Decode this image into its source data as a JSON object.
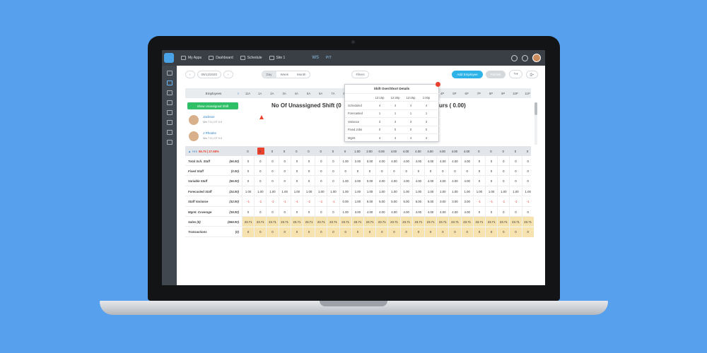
{
  "topbar": {
    "nav": [
      {
        "label": "My Apps"
      },
      {
        "label": "Dashboard"
      },
      {
        "label": "Schedule"
      },
      {
        "label": "Site 1"
      }
    ],
    "brand": "WS",
    "brand2": "PIT"
  },
  "toolbar": {
    "date": "09/13/2020",
    "views": [
      "Day",
      "Week",
      "Month"
    ],
    "active_view": "Day",
    "filters": "Filters",
    "add_employee": "Add Employee",
    "publish": "Publish"
  },
  "grid": {
    "employees_header": "Employees",
    "hours": [
      "11A",
      "1A",
      "2A",
      "3A",
      "4A",
      "5A",
      "6A",
      "7A",
      "8A",
      "9A",
      "10A",
      "11A",
      "12P",
      "1P",
      "2P",
      "3P",
      "4P",
      "5P",
      "6P",
      "7P",
      "8P",
      "9P",
      "10P",
      "11P"
    ],
    "show_unassigned": "Show Unassigned Shift",
    "title_left": "No Of Unassigned Shift (0",
    "title_right": "urs ( 0.00)",
    "employees": [
      {
        "name": "Jackson",
        "hours": "Min 7.5 | OT 0.0"
      },
      {
        "name": "J Rhodes",
        "hours": "Min 7.5 | OT 0.0"
      }
    ],
    "hrs_summary": {
      "label": "Hrs",
      "value": "56.75 | 27.68%"
    },
    "hrs_values": [
      "0",
      "0",
      "0",
      "0",
      "0",
      "0",
      "0",
      "0",
      "0",
      "1.00",
      "2.00",
      "0.00",
      "4.00",
      "4.00",
      "4.00",
      "4.00",
      "4.00",
      "4.00",
      "4.00",
      "0",
      "0",
      "0",
      "0",
      "0"
    ],
    "rows": [
      {
        "label": "Total Sch. Staff",
        "value": "(56.00)",
        "cells": [
          "0",
          "0",
          "0",
          "0",
          "0",
          "0",
          "0",
          "0",
          "1.00",
          "2.00",
          "0.00",
          "4.00",
          "4.00",
          "4.00",
          "4.00",
          "4.00",
          "4.00",
          "4.00",
          "4.00",
          "0",
          "0",
          "0",
          "0",
          "0"
        ]
      },
      {
        "label": "Fixed Staff",
        "value": "(0.00)",
        "cells": [
          "0",
          "0",
          "0",
          "0",
          "0",
          "0",
          "0",
          "0",
          "0",
          "0",
          "0",
          "0",
          "0",
          "0",
          "0",
          "0",
          "0",
          "0",
          "0",
          "0",
          "0",
          "0",
          "0",
          "0"
        ]
      },
      {
        "label": "Variable Staff",
        "value": "(56.00)",
        "cells": [
          "0",
          "0",
          "0",
          "0",
          "0",
          "0",
          "0",
          "0",
          "1.00",
          "2.00",
          "0.00",
          "4.00",
          "4.00",
          "4.00",
          "4.00",
          "4.00",
          "4.00",
          "4.00",
          "4.00",
          "0",
          "0",
          "0",
          "0",
          "0"
        ]
      },
      {
        "label": "Forecasted Staff",
        "value": "(24.00)",
        "cells": [
          "1.00",
          "1.00",
          "1.00",
          "1.00",
          "1.00",
          "1.00",
          "1.00",
          "1.00",
          "1.00",
          "1.00",
          "1.00",
          "1.00",
          "1.00",
          "1.00",
          "1.00",
          "1.00",
          "1.00",
          "1.00",
          "1.00",
          "1.00",
          "1.00",
          "1.00",
          "1.00",
          "1.00"
        ]
      },
      {
        "label": "Staff Variance",
        "value": "(32.00)",
        "cells": [
          "-1",
          "-1",
          "-1",
          "-1",
          "-1",
          "-1",
          "-1",
          "-1",
          "0.00",
          "1.00",
          "5.00",
          "5.00",
          "5.00",
          "5.00",
          "5.00",
          "5.00",
          "3.00",
          "3.00",
          "3.00",
          "-1",
          "-1",
          "-1",
          "-1",
          "-1"
        ]
      },
      {
        "label": "Mgmt. Coverage",
        "value": "(39.00)",
        "cells": [
          "0",
          "0",
          "0",
          "0",
          "0",
          "0",
          "0",
          "0",
          "1.00",
          "3.00",
          "4.00",
          "4.00",
          "4.00",
          "4.00",
          "4.00",
          "4.00",
          "4.00",
          "4.00",
          "4.00",
          "0",
          "0",
          "0",
          "0",
          "0"
        ]
      },
      {
        "label": "Sales ($)",
        "value": "(569.00)",
        "cells": [
          "23.71",
          "23.71",
          "23.71",
          "23.71",
          "23.71",
          "23.71",
          "23.71",
          "23.71",
          "23.71",
          "23.71",
          "23.71",
          "23.71",
          "23.71",
          "23.71",
          "23.71",
          "23.71",
          "23.71",
          "23.71",
          "23.71",
          "23.71",
          "23.71",
          "23.71",
          "23.71",
          "23.71"
        ]
      },
      {
        "label": "Transactions",
        "value": "(0)",
        "cells": [
          "0",
          "0",
          "0",
          "0",
          "0",
          "0",
          "0",
          "0",
          "0",
          "0",
          "0",
          "0",
          "0",
          "0",
          "0",
          "0",
          "0",
          "0",
          "0",
          "0",
          "0",
          "0",
          "0",
          "0"
        ]
      }
    ]
  },
  "popup": {
    "title": "Shift Over/Short Details",
    "columns": [
      "12:15p",
      "12:30p",
      "12:45p",
      "1:00p"
    ],
    "rows": [
      {
        "label": "Scheduled",
        "cells": [
          "4",
          "4",
          "4",
          "4"
        ]
      },
      {
        "label": "Forecasted",
        "cells": [
          "1",
          "1",
          "1",
          "1"
        ]
      },
      {
        "label": "Variance",
        "cells": [
          "3",
          "3",
          "3",
          "3"
        ]
      },
      {
        "label": "Fixed Jobs",
        "cells": [
          "0",
          "0",
          "0",
          "0"
        ]
      },
      {
        "label": "Mgmt",
        "cells": [
          "4",
          "4",
          "4",
          "4"
        ]
      }
    ]
  }
}
